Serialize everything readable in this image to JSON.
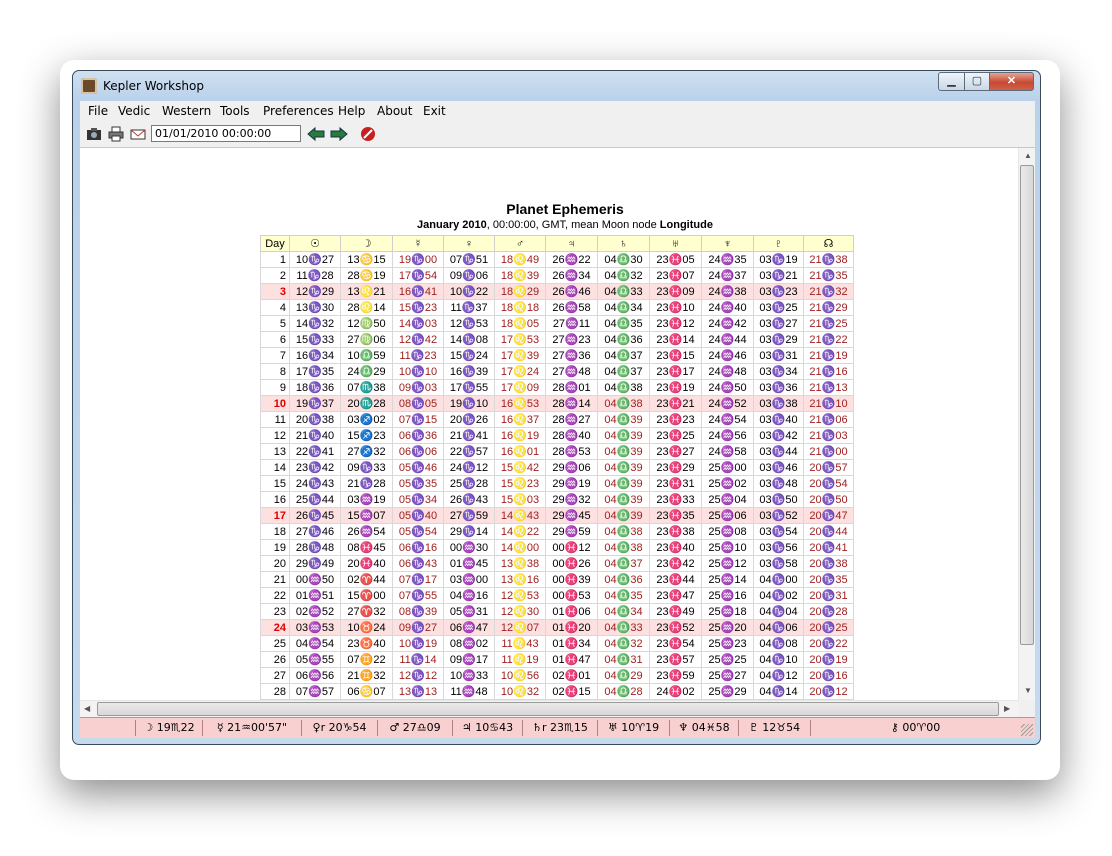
{
  "window": {
    "title": "Kepler Workshop"
  },
  "menu": [
    "File",
    "Vedic",
    "Western",
    "Tools",
    "Preferences",
    "Help",
    "About",
    "Exit"
  ],
  "toolbar": {
    "datetime": "01/01/2010   00:00:00"
  },
  "report": {
    "title": "Planet Ephemeris",
    "subtitle_month": "January  2010",
    "subtitle_mid": ", 00:00:00, GMT, mean Moon node ",
    "subtitle_end": "Longitude"
  },
  "table": {
    "headers": [
      "Day",
      "☉",
      "☽",
      "☿",
      "♀",
      "♂",
      "♃",
      "♄",
      "♅",
      "♆",
      "♇",
      "☊"
    ],
    "red_columns": [
      3,
      5,
      11
    ],
    "highlight_days": [
      3,
      10,
      17,
      24
    ],
    "rows": [
      [
        "1",
        "10♑27",
        "13♋15",
        "19♑00",
        "07♑51",
        "18♌49",
        "26♒22",
        "04♎30",
        "23♓05",
        "24♒35",
        "03♑19",
        "21♑38"
      ],
      [
        "2",
        "11♑28",
        "28♋19",
        "17♑54",
        "09♑06",
        "18♌39",
        "26♒34",
        "04♎32",
        "23♓07",
        "24♒37",
        "03♑21",
        "21♑35"
      ],
      [
        "3",
        "12♑29",
        "13♌21",
        "16♑41",
        "10♑22",
        "18♌29",
        "26♒46",
        "04♎33",
        "23♓09",
        "24♒38",
        "03♑23",
        "21♑32"
      ],
      [
        "4",
        "13♑30",
        "28♌14",
        "15♑23",
        "11♑37",
        "18♌18",
        "26♒58",
        "04♎34",
        "23♓10",
        "24♒40",
        "03♑25",
        "21♑29"
      ],
      [
        "5",
        "14♑32",
        "12♍50",
        "14♑03",
        "12♑53",
        "18♌05",
        "27♒11",
        "04♎35",
        "23♓12",
        "24♒42",
        "03♑27",
        "21♑25"
      ],
      [
        "6",
        "15♑33",
        "27♍06",
        "12♑42",
        "14♑08",
        "17♌53",
        "27♒23",
        "04♎36",
        "23♓14",
        "24♒44",
        "03♑29",
        "21♑22"
      ],
      [
        "7",
        "16♑34",
        "10♎59",
        "11♑23",
        "15♑24",
        "17♌39",
        "27♒36",
        "04♎37",
        "23♓15",
        "24♒46",
        "03♑31",
        "21♑19"
      ],
      [
        "8",
        "17♑35",
        "24♎29",
        "10♑10",
        "16♑39",
        "17♌24",
        "27♒48",
        "04♎37",
        "23♓17",
        "24♒48",
        "03♑34",
        "21♑16"
      ],
      [
        "9",
        "18♑36",
        "07♏38",
        "09♑03",
        "17♑55",
        "17♌09",
        "28♒01",
        "04♎38",
        "23♓19",
        "24♒50",
        "03♑36",
        "21♑13"
      ],
      [
        "10",
        "19♑37",
        "20♏28",
        "08♑05",
        "19♑10",
        "16♌53",
        "28♒14",
        "04♎38",
        "23♓21",
        "24♒52",
        "03♑38",
        "21♑10"
      ],
      [
        "11",
        "20♑38",
        "03♐02",
        "07♑15",
        "20♑26",
        "16♌37",
        "28♒27",
        "04♎39",
        "23♓23",
        "24♒54",
        "03♑40",
        "21♑06"
      ],
      [
        "12",
        "21♑40",
        "15♐23",
        "06♑36",
        "21♑41",
        "16♌19",
        "28♒40",
        "04♎39",
        "23♓25",
        "24♒56",
        "03♑42",
        "21♑03"
      ],
      [
        "13",
        "22♑41",
        "27♐32",
        "06♑06",
        "22♑57",
        "16♌01",
        "28♒53",
        "04♎39",
        "23♓27",
        "24♒58",
        "03♑44",
        "21♑00"
      ],
      [
        "14",
        "23♑42",
        "09♑33",
        "05♑46",
        "24♑12",
        "15♌42",
        "29♒06",
        "04♎39",
        "23♓29",
        "25♒00",
        "03♑46",
        "20♑57"
      ],
      [
        "15",
        "24♑43",
        "21♑28",
        "05♑35",
        "25♑28",
        "15♌23",
        "29♒19",
        "04♎39",
        "23♓31",
        "25♒02",
        "03♑48",
        "20♑54"
      ],
      [
        "16",
        "25♑44",
        "03♒19",
        "05♑34",
        "26♑43",
        "15♌03",
        "29♒32",
        "04♎39",
        "23♓33",
        "25♒04",
        "03♑50",
        "20♑50"
      ],
      [
        "17",
        "26♑45",
        "15♒07",
        "05♑40",
        "27♑59",
        "14♌43",
        "29♒45",
        "04♎39",
        "23♓35",
        "25♒06",
        "03♑52",
        "20♑47"
      ],
      [
        "18",
        "27♑46",
        "26♒54",
        "05♑54",
        "29♑14",
        "14♌22",
        "29♒59",
        "04♎38",
        "23♓38",
        "25♒08",
        "03♑54",
        "20♑44"
      ],
      [
        "19",
        "28♑48",
        "08♓45",
        "06♑16",
        "00♒30",
        "14♌00",
        "00♓12",
        "04♎38",
        "23♓40",
        "25♒10",
        "03♑56",
        "20♑41"
      ],
      [
        "20",
        "29♑49",
        "20♓40",
        "06♑43",
        "01♒45",
        "13♌38",
        "00♓26",
        "04♎37",
        "23♓42",
        "25♒12",
        "03♑58",
        "20♑38"
      ],
      [
        "21",
        "00♒50",
        "02♈44",
        "07♑17",
        "03♒00",
        "13♌16",
        "00♓39",
        "04♎36",
        "23♓44",
        "25♒14",
        "04♑00",
        "20♑35"
      ],
      [
        "22",
        "01♒51",
        "15♈00",
        "07♑55",
        "04♒16",
        "12♌53",
        "00♓53",
        "04♎35",
        "23♓47",
        "25♒16",
        "04♑02",
        "20♑31"
      ],
      [
        "23",
        "02♒52",
        "27♈32",
        "08♑39",
        "05♒31",
        "12♌30",
        "01♓06",
        "04♎34",
        "23♓49",
        "25♒18",
        "04♑04",
        "20♑28"
      ],
      [
        "24",
        "03♒53",
        "10♉24",
        "09♑27",
        "06♒47",
        "12♌07",
        "01♓20",
        "04♎33",
        "23♓52",
        "25♒20",
        "04♑06",
        "20♑25"
      ],
      [
        "25",
        "04♒54",
        "23♉40",
        "10♑19",
        "08♒02",
        "11♌43",
        "01♓34",
        "04♎32",
        "23♓54",
        "25♒23",
        "04♑08",
        "20♑22"
      ],
      [
        "26",
        "05♒55",
        "07♊22",
        "11♑14",
        "09♒17",
        "11♌19",
        "01♓47",
        "04♎31",
        "23♓57",
        "25♒25",
        "04♑10",
        "20♑19"
      ],
      [
        "27",
        "06♒56",
        "21♊32",
        "12♑12",
        "10♒33",
        "10♌56",
        "02♓01",
        "04♎29",
        "23♓59",
        "25♒27",
        "04♑12",
        "20♑16"
      ],
      [
        "28",
        "07♒57",
        "06♋07",
        "13♑13",
        "11♒48",
        "10♌32",
        "02♓15",
        "04♎28",
        "24♓02",
        "25♒29",
        "04♑14",
        "20♑12"
      ],
      [
        "29",
        "08♒58",
        "21♋03",
        "14♑17",
        "13♒03",
        "10♌08",
        "02♓29",
        "04♎26",
        "24♓05",
        "25♒31",
        "04♑16",
        "20♑09"
      ],
      [
        "30",
        "09♒59",
        "06♌14",
        "15♑24",
        "14♒19",
        "09♌44",
        "02♓43",
        "04♎25",
        "24♓07",
        "25♒33",
        "04♑18",
        "20♑06"
      ]
    ]
  },
  "statusbar": [
    "☽ 19♏22",
    "☿ 21♒00'57\"",
    "♀r 20♑54",
    "♂ 27♎09",
    "♃ 10♋43",
    "♄r 23♏15",
    "♅ 10♈19",
    "♆ 04♓58",
    "♇ 12♉54",
    "⚷ 00♈00"
  ],
  "colors": {
    "header_bg": "#ffffd0",
    "highlight_row": "#fde0e0",
    "red_text": "#a02020",
    "day_red": "#e00000",
    "status_bg": "#f8d0d0"
  }
}
